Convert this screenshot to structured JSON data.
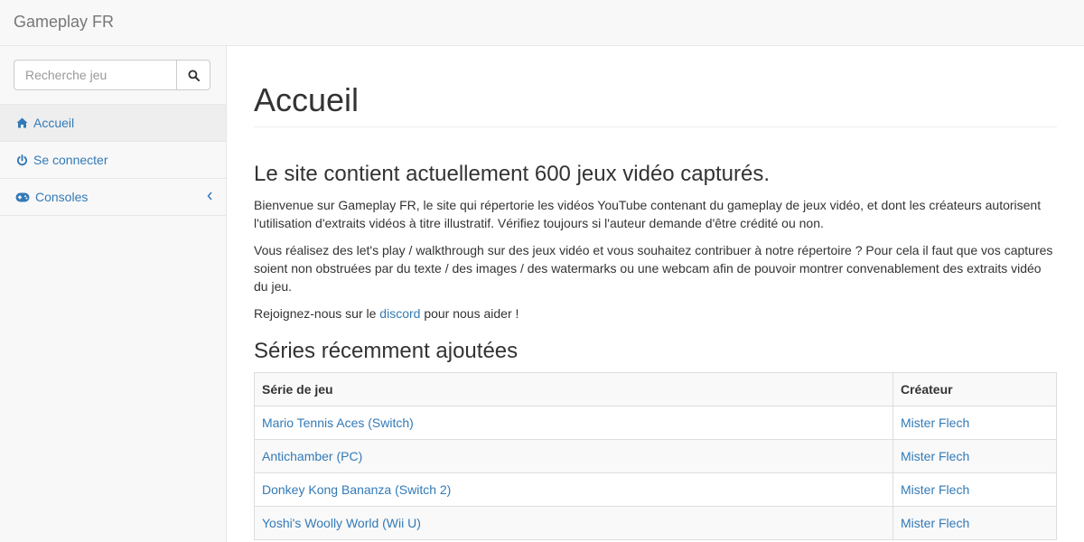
{
  "header": {
    "brand": "Gameplay FR"
  },
  "sidebar": {
    "search": {
      "placeholder": "Recherche jeu",
      "value": ""
    },
    "items": [
      {
        "label": "Accueil",
        "icon": "home-icon",
        "active": true
      },
      {
        "label": "Se connecter",
        "icon": "power-icon",
        "active": false
      },
      {
        "label": "Consoles",
        "icon": "gamepad-icon",
        "active": false
      }
    ]
  },
  "main": {
    "title": "Accueil",
    "lead": "Le site contient actuellement 600 jeux vidéo capturés.",
    "paragraph1": "Bienvenue sur Gameplay FR, le site qui répertorie les vidéos YouTube contenant du gameplay de jeux vidéo, et dont les créateurs autorisent l'utilisation d'extraits vidéos à titre illustratif. Vérifiez toujours si l'auteur demande d'être crédité ou non.",
    "paragraph2": "Vous réalisez des let's play / walkthrough sur des jeux vidéo et vous souhaitez contribuer à notre répertoire ? Pour cela il faut que vos captures soient non obstruées par du texte / des images / des watermarks ou une webcam afin de pouvoir montrer convenablement des extraits vidéo du jeu.",
    "join_before": "Rejoignez-nous sur le ",
    "join_link": "discord",
    "join_after": " pour nous aider !",
    "recent_title": "Séries récemment ajoutées",
    "table": {
      "headers": [
        "Série de jeu",
        "Créateur"
      ],
      "rows": [
        [
          "Mario Tennis Aces (Switch)",
          "Mister Flech"
        ],
        [
          "Antichamber (PC)",
          "Mister Flech"
        ],
        [
          "Donkey Kong Bananza (Switch 2)",
          "Mister Flech"
        ],
        [
          "Yoshi's Woolly World (Wii U)",
          "Mister Flech"
        ]
      ]
    }
  },
  "colors": {
    "link": "#337ab7",
    "navbar_bg": "#f8f8f8",
    "active_bg": "#eeeeee"
  }
}
